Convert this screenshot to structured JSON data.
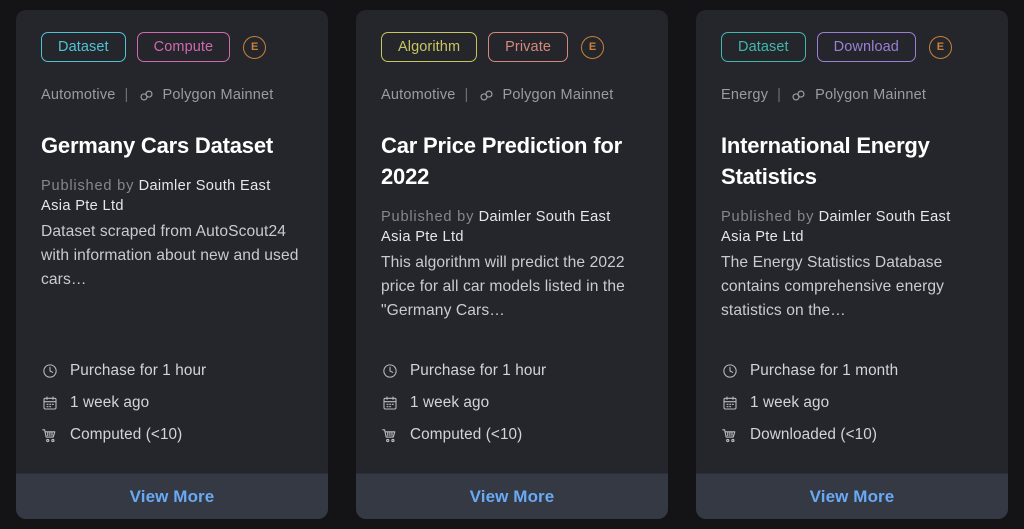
{
  "page": {
    "background": "#141416",
    "card_background": "#24262b",
    "footer_background": "#343943",
    "link_color": "#6aa9f4"
  },
  "cards": [
    {
      "badges": [
        {
          "label": "Dataset",
          "color": "#4fc3d5",
          "name": "badge-dataset"
        },
        {
          "label": "Compute",
          "color": "#d069b0",
          "name": "badge-compute"
        }
      ],
      "e_badge": {
        "label": "E",
        "color": "#c8813a"
      },
      "category": "Automotive",
      "separator": "|",
      "network": "Polygon Mainnet",
      "title": "Germany Cars Dataset",
      "published_label": "Published by",
      "publisher": "Daimler South East Asia Pte Ltd",
      "description": "Dataset scraped from AutoScout24 with information about new and used cars…",
      "meta": [
        {
          "icon": "clock-icon",
          "text": "Purchase for 1 hour"
        },
        {
          "icon": "calendar-icon",
          "text": "1 week ago"
        },
        {
          "icon": "cart-icon",
          "text": "Computed (<10)"
        }
      ],
      "footer_label": "View More"
    },
    {
      "badges": [
        {
          "label": "Algorithm",
          "color": "#c7c561",
          "name": "badge-algorithm"
        },
        {
          "label": "Private",
          "color": "#d6887c",
          "name": "badge-private"
        }
      ],
      "e_badge": {
        "label": "E",
        "color": "#c8813a"
      },
      "category": "Automotive",
      "separator": "|",
      "network": "Polygon Mainnet",
      "title": "Car Price Prediction for 2022",
      "published_label": "Published by",
      "publisher": "Daimler South East Asia Pte Ltd",
      "description": "This algorithm will predict the 2022 price for all car models listed in the \"Germany Cars…",
      "meta": [
        {
          "icon": "clock-icon",
          "text": "Purchase for 1 hour"
        },
        {
          "icon": "calendar-icon",
          "text": "1 week ago"
        },
        {
          "icon": "cart-icon",
          "text": "Computed (<10)"
        }
      ],
      "footer_label": "View More"
    },
    {
      "badges": [
        {
          "label": "Dataset",
          "color": "#43b6ad",
          "name": "badge-dataset"
        },
        {
          "label": "Download",
          "color": "#9b7fd4",
          "name": "badge-download"
        }
      ],
      "e_badge": {
        "label": "E",
        "color": "#c8813a"
      },
      "category": "Energy",
      "separator": "|",
      "network": "Polygon Mainnet",
      "title": "International Energy Statistics",
      "published_label": "Published by",
      "publisher": "Daimler South East Asia Pte Ltd",
      "description": "The Energy Statistics Database contains comprehensive energy statistics on the…",
      "meta": [
        {
          "icon": "clock-icon",
          "text": "Purchase for 1 month"
        },
        {
          "icon": "calendar-icon",
          "text": "1 week ago"
        },
        {
          "icon": "cart-icon",
          "text": "Downloaded (<10)"
        }
      ],
      "footer_label": "View More"
    }
  ]
}
